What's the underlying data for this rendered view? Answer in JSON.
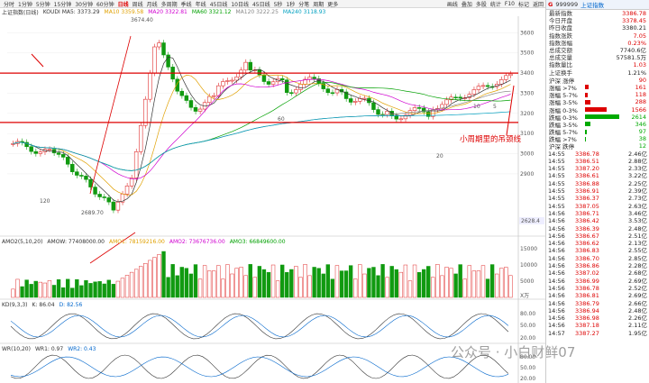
{
  "toolbar": {
    "periods": [
      "分时",
      "1分钟",
      "5分钟",
      "15分钟",
      "30分钟",
      "60分钟",
      "日线",
      "周线",
      "月线",
      "多周期",
      "季线",
      "年线",
      "45日线",
      "10日线",
      "45日线",
      "5秒",
      "1秒",
      "分笔",
      "周期",
      "更多"
    ],
    "active_index": 6,
    "right_tabs": [
      "画线",
      "叠加",
      "多股",
      "统计",
      "F10",
      "标记",
      "返回"
    ]
  },
  "index_name": "上证指数(日线)",
  "ma_legend": {
    "items": [
      {
        "label": "KOUDI",
        "value": "MA5: 3373.29",
        "color": "#333333"
      },
      {
        "label": "MA10",
        "value": "3359.58",
        "color": "#e0a000"
      },
      {
        "label": "MA20",
        "value": "3322.81",
        "color": "#d000d0"
      },
      {
        "label": "MA60",
        "value": "3321.12",
        "color": "#00a000"
      },
      {
        "label": "MA120",
        "value": "3222.25",
        "color": "#888888"
      },
      {
        "label": "MA240",
        "value": "3118.93",
        "color": "#00a0c0"
      }
    ]
  },
  "price_axis": [
    "3600",
    "3500",
    "3400",
    "3300",
    "3200",
    "3100",
    "3000",
    "2900"
  ],
  "price_labels": {
    "high": "3674.40",
    "low": "2689.70",
    "last": "2628.4"
  },
  "marker_labels": [
    "120",
    "60",
    "20",
    "10",
    "5"
  ],
  "annotation": "小周期里的吊颈线",
  "volume_legend": {
    "items": [
      "AMO2(5,10,20)",
      "AMOW: 77408000.00",
      "AMO1: 78159216.00",
      "AMO2: 73676736.00",
      "AMO3: 66849600.00"
    ]
  },
  "volume_axis": [
    "15000",
    "10000",
    "5000",
    "X万"
  ],
  "kdj_legend": {
    "items": [
      "KD(9,3,3)",
      "K: 86.04",
      "D: 82.56"
    ]
  },
  "kdj_axis": [
    "80.00",
    "50.00",
    "20.00"
  ],
  "wr_legend": {
    "items": [
      "WR(10,20)",
      "WR1: 0.97",
      "WR2: 0.43"
    ]
  },
  "wr_axis": [
    "80.00",
    "50.00",
    "20.00"
  ],
  "quote": {
    "g_label": "G",
    "code": "999999",
    "name": "上证指数",
    "rows": [
      {
        "k": "最新指数",
        "v": "3386.78",
        "c": "red"
      },
      {
        "k": "今日开盘",
        "v": "3378.45",
        "c": "red"
      },
      {
        "k": "昨日收盘",
        "v": "3380.21",
        "c": ""
      },
      {
        "k": "指数涨跌",
        "v": "7.05",
        "c": "red"
      },
      {
        "k": "指数涨幅",
        "v": "0.23%",
        "c": "red"
      },
      {
        "k": "总成交额",
        "v": "7740.6亿",
        "c": ""
      },
      {
        "k": "总成交量",
        "v": "57581.5万",
        "c": ""
      },
      {
        "k": "指数量比",
        "v": "1.03",
        "c": "red"
      },
      {
        "k": "上证换手",
        "v": "1.21%",
        "c": ""
      }
    ]
  },
  "distribution": [
    {
      "k": "沪深 涨停",
      "v": "90",
      "c": "red",
      "w": 0,
      "col": "#d00"
    },
    {
      "k": "涨幅 >7%",
      "v": "161",
      "c": "red",
      "w": 4,
      "col": "#d00"
    },
    {
      "k": "涨幅 5-7%",
      "v": "118",
      "c": "red",
      "w": 3,
      "col": "#d00"
    },
    {
      "k": "涨幅 3-5%",
      "v": "288",
      "c": "red",
      "w": 6,
      "col": "#d00"
    },
    {
      "k": "涨幅 0-3%",
      "v": "1566",
      "c": "red",
      "w": 24,
      "col": "#d00"
    },
    {
      "k": "跌幅 0-3%",
      "v": "2614",
      "c": "grn",
      "w": 38,
      "col": "#0a0"
    },
    {
      "k": "跌幅 3-5%",
      "v": "346",
      "c": "grn",
      "w": 6,
      "col": "#0a0"
    },
    {
      "k": "跌幅 5-7%",
      "v": "97",
      "c": "grn",
      "w": 2,
      "col": "#0a0"
    },
    {
      "k": "跌幅 >7%",
      "v": "38",
      "c": "grn",
      "w": 1,
      "col": "#0a0"
    },
    {
      "k": "沪深 跌停",
      "v": "12",
      "c": "grn",
      "w": 0,
      "col": "#0a0"
    }
  ],
  "ticks": [
    {
      "t": "14:55",
      "p": "3386.78",
      "v": "2.46亿"
    },
    {
      "t": "14:55",
      "p": "3386.51",
      "v": "2.88亿"
    },
    {
      "t": "14:55",
      "p": "3387.20",
      "v": "2.33亿"
    },
    {
      "t": "14:55",
      "p": "3386.61",
      "v": "3.22亿"
    },
    {
      "t": "14:55",
      "p": "3386.88",
      "v": "2.25亿"
    },
    {
      "t": "14:55",
      "p": "3386.91",
      "v": "2.39亿"
    },
    {
      "t": "14:55",
      "p": "3386.37",
      "v": "2.73亿"
    },
    {
      "t": "14:55",
      "p": "3387.05",
      "v": "2.63亿"
    },
    {
      "t": "14:56",
      "p": "3386.71",
      "v": "3.46亿"
    },
    {
      "t": "14:56",
      "p": "3386.42",
      "v": "3.53亿"
    },
    {
      "t": "14:56",
      "p": "3386.39",
      "v": "2.48亿"
    },
    {
      "t": "14:56",
      "p": "3386.67",
      "v": "2.51亿"
    },
    {
      "t": "14:56",
      "p": "3386.62",
      "v": "2.13亿"
    },
    {
      "t": "14:56",
      "p": "3386.83",
      "v": "2.55亿"
    },
    {
      "t": "14:56",
      "p": "3386.70",
      "v": "2.85亿"
    },
    {
      "t": "14:56",
      "p": "3386.86",
      "v": "2.28亿"
    },
    {
      "t": "14:56",
      "p": "3387.02",
      "v": "2.68亿"
    },
    {
      "t": "14:56",
      "p": "3386.99",
      "v": "2.69亿"
    },
    {
      "t": "14:56",
      "p": "3386.78",
      "v": "2.52亿"
    },
    {
      "t": "14:56",
      "p": "3386.81",
      "v": "2.69亿"
    },
    {
      "t": "14:56",
      "p": "3386.79",
      "v": "2.66亿"
    },
    {
      "t": "14:56",
      "p": "3386.94",
      "v": "2.48亿"
    },
    {
      "t": "14:56",
      "p": "3386.98",
      "v": "2.26亿"
    },
    {
      "t": "14:56",
      "p": "3387.18",
      "v": "2.11亿"
    },
    {
      "t": "14:57",
      "p": "3387.27",
      "v": "1.95亿"
    }
  ],
  "watermark": "公众号 · 小白财鲜07"
}
